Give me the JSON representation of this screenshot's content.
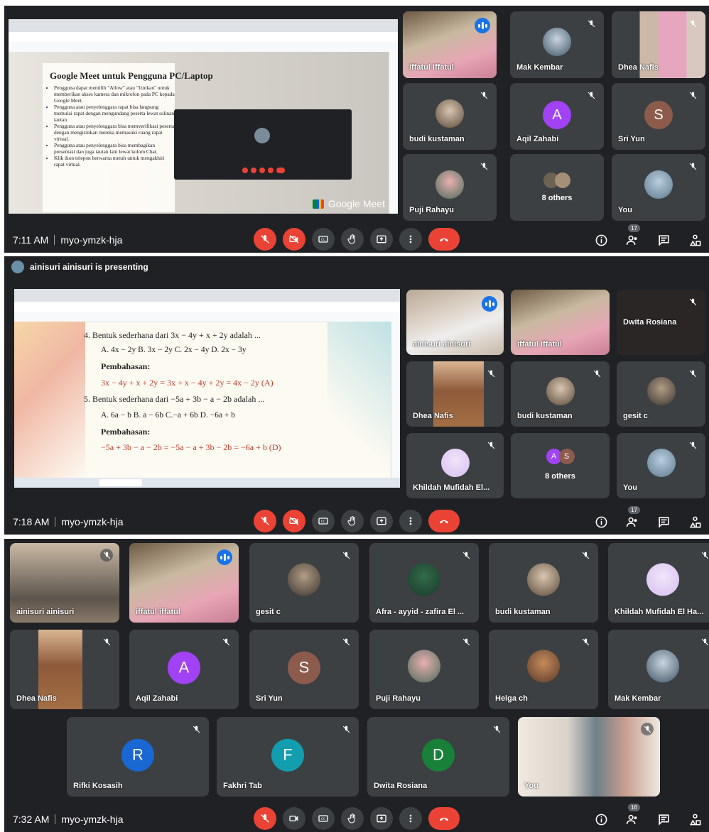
{
  "panel1": {
    "time": "7:11 AM",
    "meeting_code": "myo-ymzk-hja",
    "participants_count": "17",
    "slide": {
      "title": "Google Meet untuk Pengguna PC/Laptop",
      "bullets": [
        "Pengguna dapat memilih \"Allow\" atau \"Izinkan\" untuk memberikan akses kamera dan mikrofon pada PC kepada Google Meet.",
        "Pengguna atau penyelenggara rapat bisa langsung memulai rapat dengan mengundang peserta lewat salinan tautan.",
        "Pengguna atau penyelenggara bisa memverifikasi peserta dengan mengizinkan mereka memasuki ruang rapat virtual.",
        "Pengguna atau penyelenggara bisa membagikan presentasi dan juga tautan lain lewat kolom Chat.",
        "Klik ikon telepon berwarna merah untuk mengakhiri rapat virtual."
      ],
      "logo_text": "Google Meet"
    },
    "tiles": [
      {
        "name": "iffatul iffatul"
      },
      {
        "name": "Mak Kembar"
      },
      {
        "name": "Dhea Nafis"
      },
      {
        "name": "budi kustaman"
      },
      {
        "name": "Aqil Zahabi",
        "letter": "A"
      },
      {
        "name": "Sri Yun",
        "letter": "S"
      },
      {
        "name": "Puji Rahayu"
      },
      {
        "name": "8 others"
      },
      {
        "name": "You"
      }
    ]
  },
  "panel2": {
    "presenting": "ainisuri ainisuri is presenting",
    "time": "7:18 AM",
    "meeting_code": "myo-ymzk-hja",
    "participants_count": "17",
    "slide": {
      "q4": "4.  Bentuk sederhana dari 3x − 4y + x + 2y adalah ...",
      "q4_opts": "A. 4x − 2y     B. 3x − 2y     C. 2x − 4y     D. 2x − 3y",
      "pembahasan": "Pembahasan:",
      "a4": "3x − 4y + x + 2y = 3x + x − 4y + 2y = 4x − 2y (A)",
      "q5": "5.  Bentuk sederhana dari −5a + 3b − a − 2b adalah ...",
      "q5_opts": "A. 6a − b     B. a − 6b     C.−a + 6b     D. −6a + b",
      "a5": "−5a + 3b − a − 2b = −5a − a + 3b − 2b = −6a + b (D)"
    },
    "tiles": [
      {
        "name": "ainisuri ainisuri"
      },
      {
        "name": "iffatul iffatul"
      },
      {
        "name": "Dwita Rosiana"
      },
      {
        "name": "Dhea Nafis"
      },
      {
        "name": "budi kustaman"
      },
      {
        "name": "gesit c"
      },
      {
        "name": "Khildah Mufidah El..."
      },
      {
        "name": "8 others",
        "letters": [
          "A",
          "S"
        ]
      },
      {
        "name": "You"
      }
    ]
  },
  "panel3": {
    "time": "7:32 AM",
    "meeting_code": "myo-ymzk-hja",
    "participants_count": "16",
    "tiles": [
      {
        "name": "ainisuri ainisuri"
      },
      {
        "name": "iffatul iffatul"
      },
      {
        "name": "gesit c"
      },
      {
        "name": "Afra - ayyid - zafira El ..."
      },
      {
        "name": "budi kustaman"
      },
      {
        "name": "Khildah Mufidah El Ha..."
      },
      {
        "name": "Dhea Nafis"
      },
      {
        "name": "Aqil Zahabi",
        "letter": "A"
      },
      {
        "name": "Sri Yun",
        "letter": "S"
      },
      {
        "name": "Puji Rahayu"
      },
      {
        "name": "Helga ch"
      },
      {
        "name": "Mak Kembar"
      },
      {
        "name": "Rifki Kosasih",
        "letter": "R"
      },
      {
        "name": "Fakhri Tab",
        "letter": "F"
      },
      {
        "name": "Dwita Rosiana",
        "letter": "D"
      },
      {
        "name": "You"
      }
    ]
  },
  "colors": {
    "background": "#202124",
    "tile": "#3c4043",
    "end_call": "#ea4335",
    "active_speaker": "#8ab4f8",
    "avatar_purple": "#a142f4",
    "avatar_brown": "#8d5b4c",
    "avatar_blue": "#1967d2",
    "avatar_teal": "#129eaf",
    "avatar_green": "#188038"
  }
}
